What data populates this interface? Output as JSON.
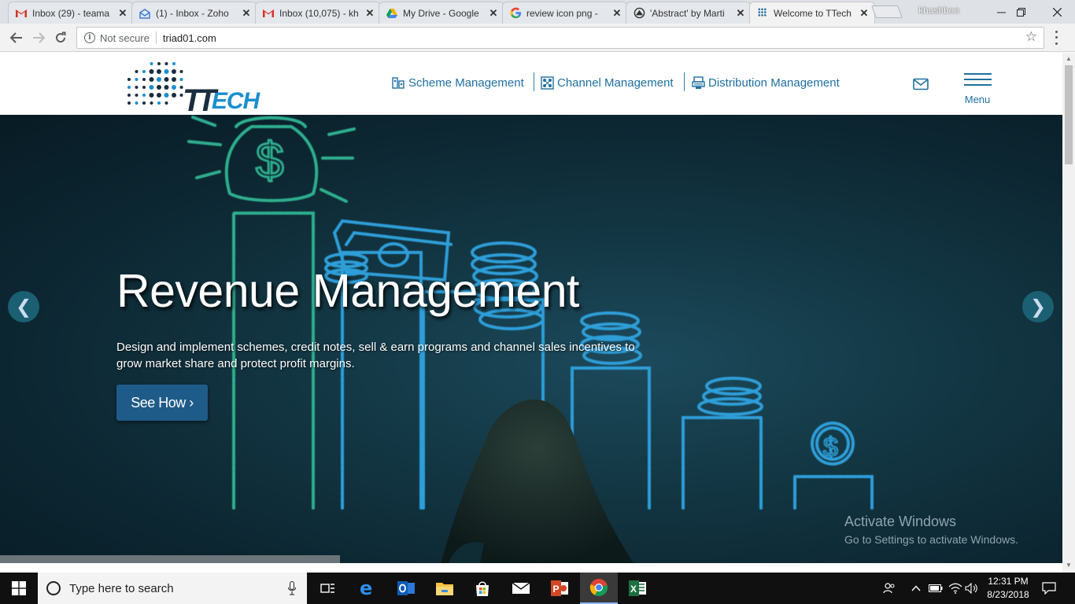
{
  "browser": {
    "tabs": [
      {
        "title": "Inbox (29) - teama",
        "icon": "gmail-icon"
      },
      {
        "title": "(1) - Inbox - Zoho",
        "icon": "zoho-mail-icon"
      },
      {
        "title": "Inbox (10,075) - kh",
        "icon": "gmail-icon"
      },
      {
        "title": "My Drive - Google",
        "icon": "google-drive-icon"
      },
      {
        "title": "review icon png -",
        "icon": "google-icon"
      },
      {
        "title": "'Abstract' by Marti",
        "icon": "abstract-icon"
      },
      {
        "title": "Welcome to TTech",
        "icon": "ttech-icon",
        "active": true
      }
    ],
    "profile_name": "khushboo",
    "security_label": "Not secure",
    "url": "triad01.com"
  },
  "site": {
    "logo_text_tt": "TT",
    "logo_text_rest": "ECH",
    "nav": [
      {
        "label": "Scheme Management",
        "icon": "scheme-icon"
      },
      {
        "label": "Channel Management",
        "icon": "channel-icon"
      },
      {
        "label": "Distribution Management",
        "icon": "distribution-icon"
      }
    ],
    "menu_label": "Menu"
  },
  "hero": {
    "title": "Revenue Management",
    "description": "Design and implement schemes, credit notes, sell & earn programs and channel sales incentives to grow market share and protect profit margins.",
    "cta_label": "See How",
    "cta_chevron": "›",
    "prev_arrow": "❮",
    "next_arrow": "❯",
    "slide_count": 4,
    "slideshow_progress": 0.32
  },
  "watermark": {
    "line1": "Activate Windows",
    "line2": "Go to Settings to activate Windows."
  },
  "taskbar": {
    "search_placeholder": "Type here to search",
    "apps": [
      "task-view-icon",
      "edge-icon",
      "outlook-icon",
      "file-explorer-icon",
      "store-icon",
      "mail-icon",
      "powerpoint-icon",
      "chrome-icon",
      "excel-icon"
    ],
    "time": "12:31 PM",
    "date": "8/23/2018"
  },
  "colors": {
    "nav_blue": "#1f6fa0",
    "cta_blue": "#1f5b88",
    "hero_dark": "#0c2631",
    "chalk_green": "#2fae8e",
    "chalk_blue": "#2e9ed8"
  }
}
